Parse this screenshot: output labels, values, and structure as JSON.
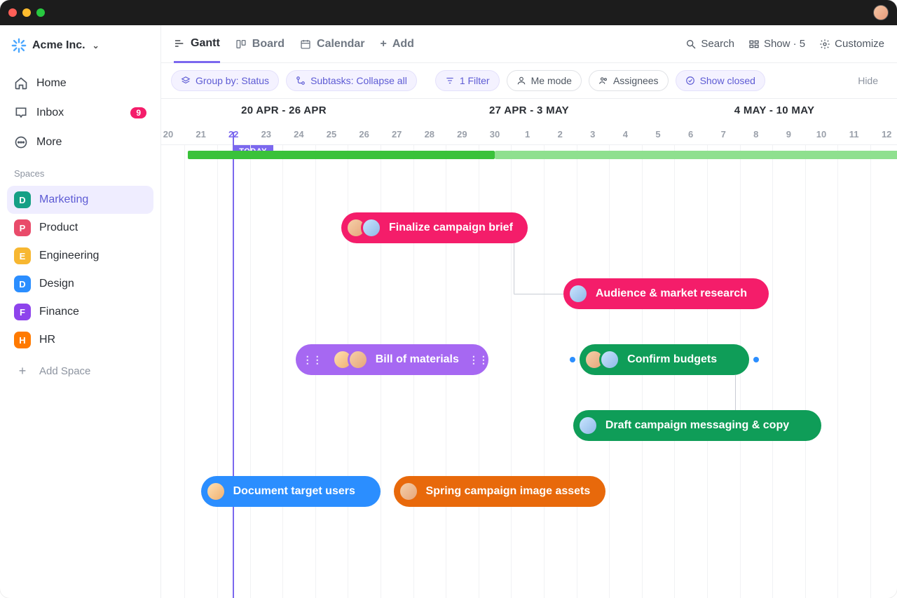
{
  "workspace": {
    "name": "Acme Inc."
  },
  "nav": {
    "home": "Home",
    "inbox": "Inbox",
    "inbox_count": "9",
    "more": "More"
  },
  "sidebar": {
    "section_label": "Spaces",
    "spaces": [
      {
        "letter": "D",
        "color": "#16a085",
        "label": "Marketing",
        "active": true
      },
      {
        "letter": "P",
        "color": "#e94b6a",
        "label": "Product"
      },
      {
        "letter": "E",
        "color": "#f7b731",
        "label": "Engineering"
      },
      {
        "letter": "D",
        "color": "#2b8eff",
        "label": "Design"
      },
      {
        "letter": "F",
        "color": "#8e44ec",
        "label": "Finance"
      },
      {
        "letter": "H",
        "color": "#ff7a00",
        "label": "HR"
      }
    ],
    "add_space": "Add Space"
  },
  "tabs": {
    "gantt": "Gantt",
    "board": "Board",
    "calendar": "Calendar",
    "add": "Add"
  },
  "toolbar_right": {
    "search": "Search",
    "show": "Show · 5",
    "customize": "Customize"
  },
  "filters": {
    "group": "Group by: Status",
    "subtasks": "Subtasks: Collapse all",
    "filter": "1 Filter",
    "me": "Me mode",
    "assignees": "Assignees",
    "closed": "Show closed",
    "hide": "Hide"
  },
  "timeline": {
    "weeks": [
      "20 APR - 26 APR",
      "27 APR - 3 MAY",
      "4 MAY - 10 MAY"
    ],
    "days": [
      "20",
      "21",
      "22",
      "23",
      "24",
      "25",
      "26",
      "27",
      "28",
      "29",
      "30",
      "1",
      "2",
      "3",
      "4",
      "5",
      "6",
      "7",
      "8",
      "9",
      "10",
      "11",
      "12"
    ],
    "today_index": 2,
    "today_label": "TODAY"
  },
  "tasks": {
    "t1": "Finalize campaign brief",
    "t2": "Audience & market research",
    "t3": "Bill of materials",
    "t4": "Confirm budgets",
    "t5": "Draft campaign messaging & copy",
    "t6": "Document target users",
    "t7": "Spring campaign image assets"
  },
  "colors": {
    "pink": "#f41d6a",
    "purple": "#a668f2",
    "green": "#0f9d58",
    "blue": "#2b8eff",
    "orange": "#e8690b"
  },
  "chart_data": {
    "type": "gantt",
    "unit": "day-index (0 = 20 Apr)",
    "range": [
      0,
      22
    ],
    "today": 2,
    "summary": [
      {
        "start": 0.6,
        "end": 10,
        "color": "#3ac23a"
      },
      {
        "start": 10,
        "end": 22.5,
        "color": "#8fe08f"
      }
    ],
    "tasks": [
      {
        "id": "t1",
        "label": "Finalize campaign brief",
        "start": 5.3,
        "end": 11,
        "row": 0,
        "color": "pink",
        "assignees": 2
      },
      {
        "id": "t2",
        "label": "Audience & market research",
        "start": 12.1,
        "end": 18.4,
        "row": 1,
        "color": "pink",
        "assignees": 1
      },
      {
        "id": "t3",
        "label": "Bill of materials",
        "start": 3.9,
        "end": 9.8,
        "row": 2,
        "color": "purple",
        "assignees": 2,
        "draggable": true
      },
      {
        "id": "t4",
        "label": "Confirm budgets",
        "start": 12.6,
        "end": 17.8,
        "row": 2,
        "color": "green",
        "assignees": 2,
        "milestones": true
      },
      {
        "id": "t5",
        "label": "Draft campaign messaging & copy",
        "start": 12.4,
        "end": 20,
        "row": 3,
        "color": "green",
        "assignees": 1
      },
      {
        "id": "t6",
        "label": "Document target users",
        "start": 1,
        "end": 6.5,
        "row": 4,
        "color": "blue",
        "assignees": 1
      },
      {
        "id": "t7",
        "label": "Spring campaign image assets",
        "start": 6.9,
        "end": 13.4,
        "row": 4,
        "color": "orange",
        "assignees": 1
      }
    ],
    "dependencies": [
      {
        "from": "t1",
        "to": "t2"
      },
      {
        "from": "t4",
        "to": "t5"
      }
    ]
  }
}
